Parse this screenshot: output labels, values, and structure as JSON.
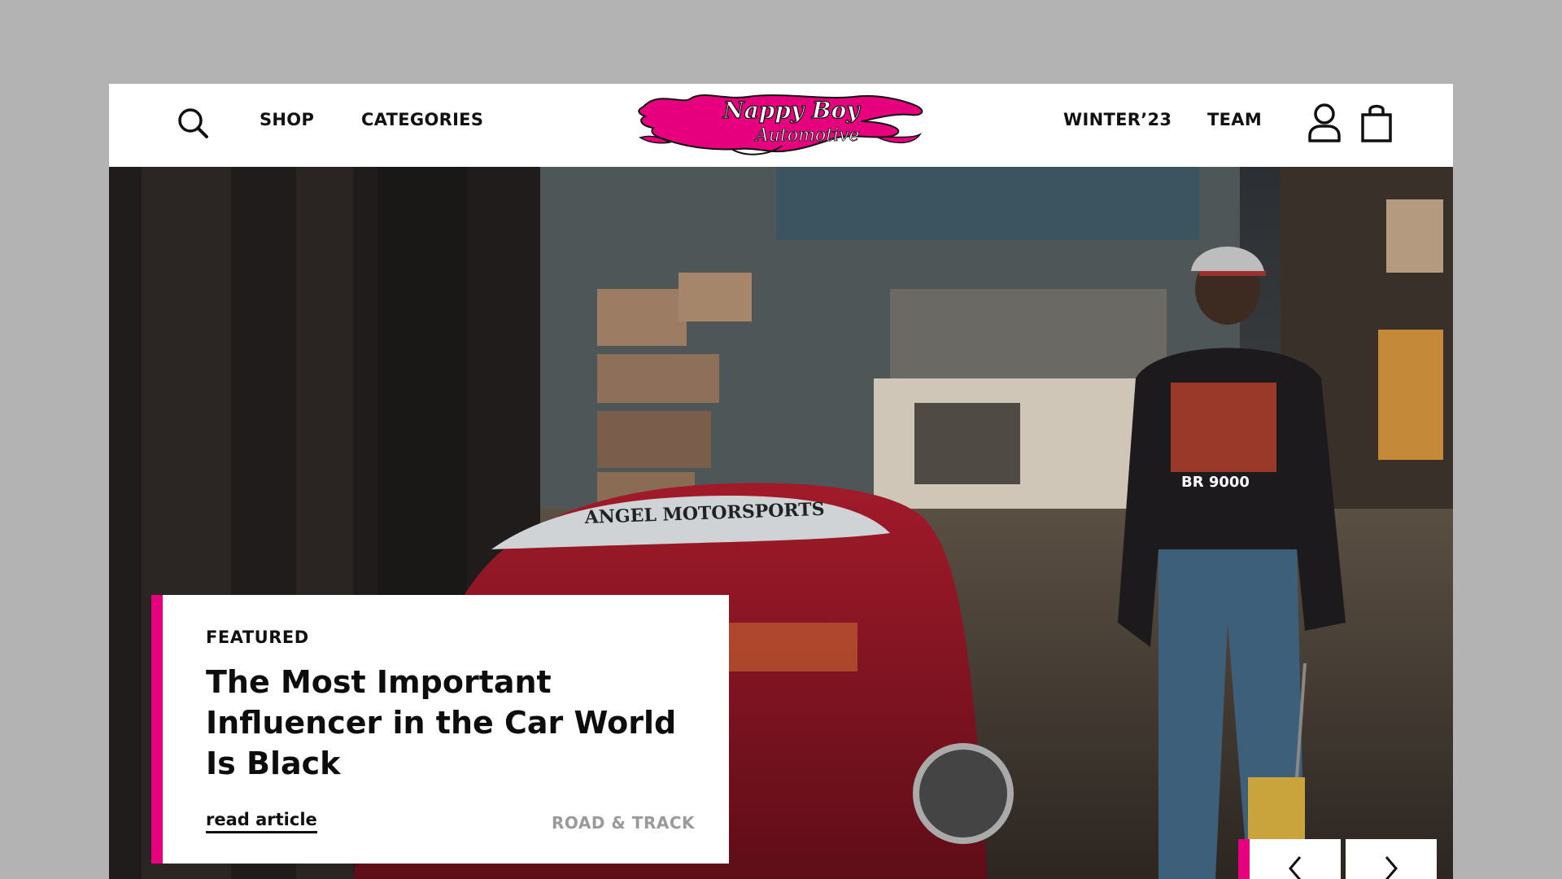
{
  "header": {
    "nav_left": [
      {
        "label": "SHOP"
      },
      {
        "label": "CATEGORIES"
      }
    ],
    "nav_right": [
      {
        "label": "WINTER’23"
      },
      {
        "label": "TEAM"
      }
    ],
    "logo": {
      "text_line1": "Nappy Boy",
      "text_line2": "Automotive",
      "color": "#e6007e"
    },
    "icons": [
      "search-icon",
      "user-icon",
      "shopping-bag-icon"
    ]
  },
  "featured": {
    "kicker": "FEATURED",
    "title": "The Most Important Influencer in the Car World Is Black",
    "link_label": "read article",
    "source": "ROAD & TRACK"
  },
  "slider": {
    "icons": [
      "chevron-left-icon",
      "chevron-right-icon"
    ]
  },
  "colors": {
    "accent": "#e6007e",
    "background": "#b3b3b3"
  }
}
